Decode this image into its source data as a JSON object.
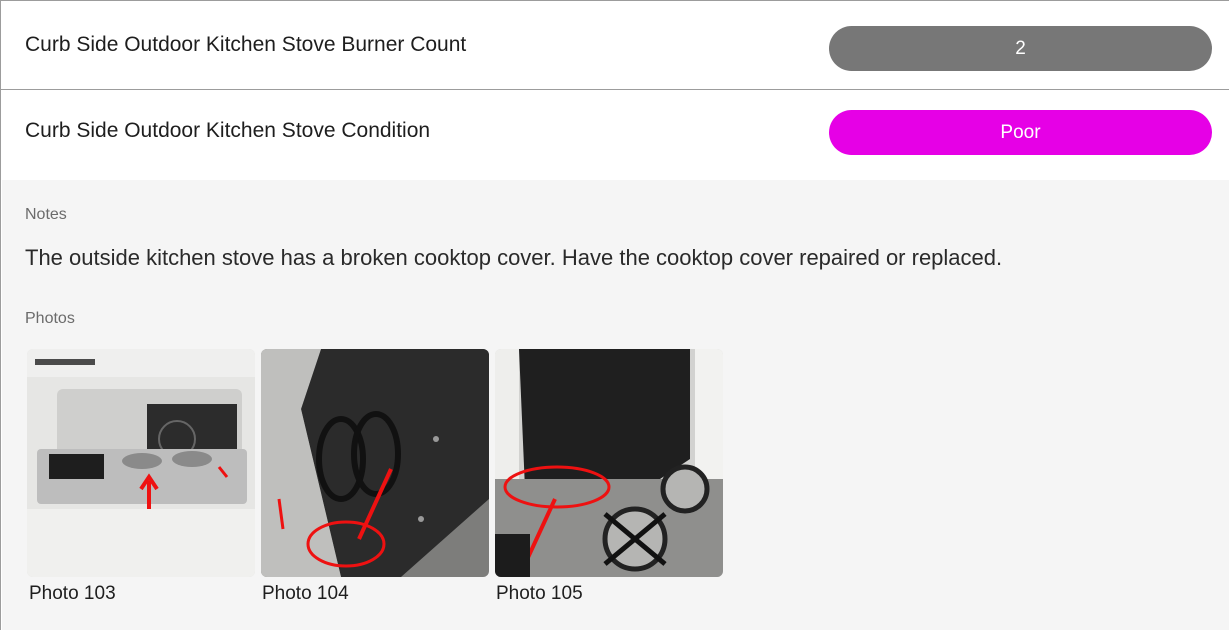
{
  "burner_count": {
    "label": "Curb Side Outdoor Kitchen Stove Burner Count",
    "value": "2"
  },
  "condition": {
    "label": "Curb Side Outdoor Kitchen Stove Condition",
    "value": "Poor",
    "color": "#e600e6"
  },
  "notes": {
    "label": "Notes",
    "text": "The outside kitchen stove has a broken cooktop cover. Have the cooktop cover repaired or replaced."
  },
  "photos": {
    "label": "Photos",
    "items": [
      {
        "caption": "Photo 103"
      },
      {
        "caption": "Photo 104"
      },
      {
        "caption": "Photo 105"
      }
    ]
  }
}
